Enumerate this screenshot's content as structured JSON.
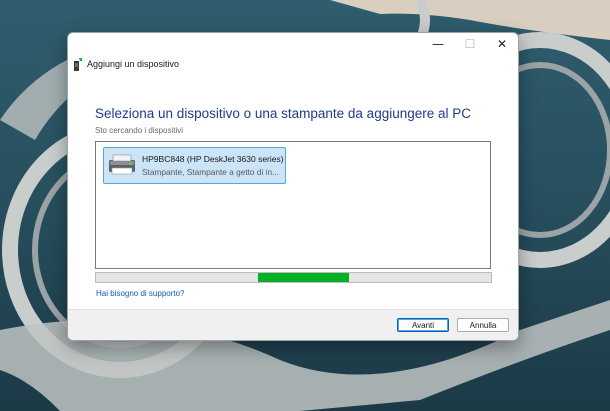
{
  "window": {
    "title": "Aggiungi un dispositivo",
    "minimize_glyph": "—",
    "maximize_glyph": "☐",
    "close_glyph": "✕"
  },
  "main": {
    "heading": "Seleziona un dispositivo o una stampante da aggiungere al PC",
    "status": "Sto cercando i dispositivi",
    "devices": [
      {
        "name": "HP9BC848 (HP DeskJet 3630 series)",
        "description": "Stampante, Stampante a getto di in...",
        "icon": "printer-icon"
      }
    ],
    "progress": {
      "indicator": "indeterminate",
      "fill_start": 0.41,
      "fill_end": 0.64,
      "color": "#06b025"
    },
    "help_link": "Hai bisogno di supporto?"
  },
  "footer": {
    "next_label": "Avanti",
    "cancel_label": "Annulla"
  },
  "colors": {
    "heading": "#1e3c8c",
    "link": "#0a5cb8",
    "selection": "#cce4f7",
    "selection_border": "#5aa3dd"
  }
}
